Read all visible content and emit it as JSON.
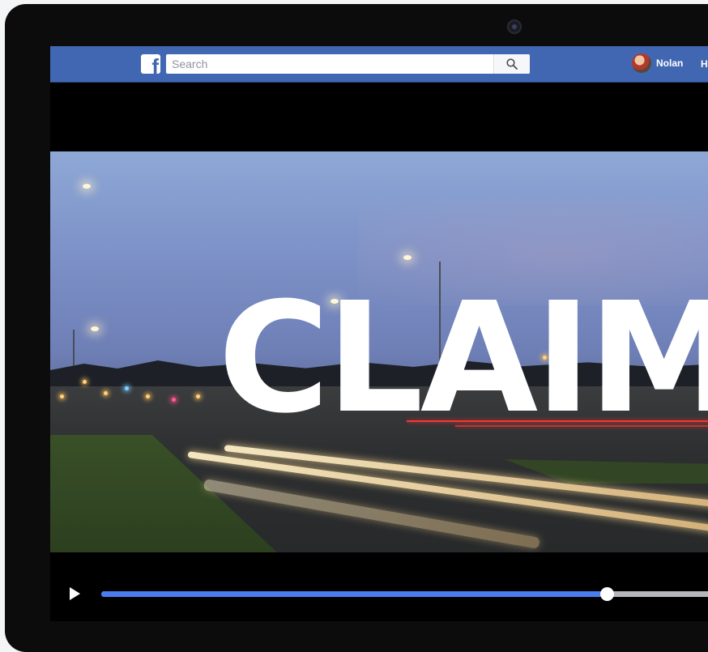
{
  "topbar": {
    "logo_letter": "f",
    "search_placeholder": "Search",
    "user_name": "Nolan",
    "nav_partial": "Ho"
  },
  "video": {
    "overlay_text": "CLAIM",
    "progress": 0.78
  },
  "icons": {
    "logo": "facebook-logo-icon",
    "search": "search-icon",
    "play": "play-icon"
  },
  "colors": {
    "brand": "#4267b2",
    "progress": "#4a7cf0"
  }
}
